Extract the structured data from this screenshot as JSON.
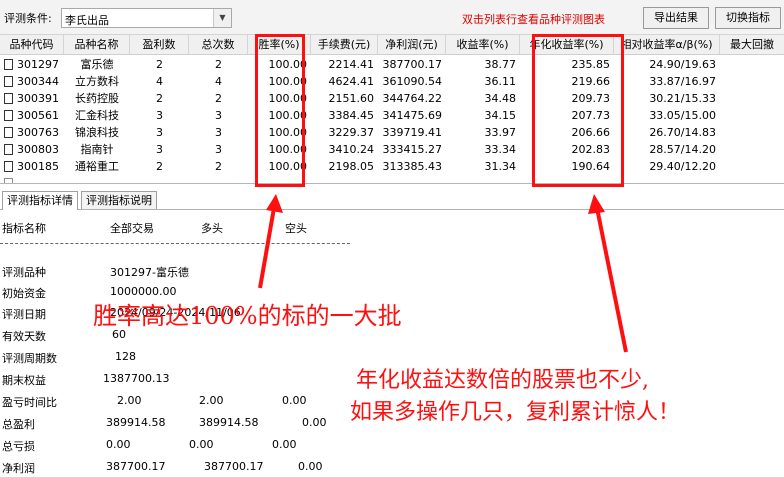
{
  "toolbar": {
    "condition_label": "评测条件:",
    "condition_value": "李氏出品",
    "hint": "双击列表行查看品种评测图表",
    "export_label": "导出结果",
    "switch_label": "切换指标"
  },
  "table": {
    "headers": [
      "品种代码",
      "品种名称",
      "盈利数",
      "总次数",
      "胜率(%)",
      "手续费(元)",
      "净利润(元)",
      "收益率(%)",
      "年化收益率(%)",
      "相对收益率α/β(%)",
      "最大回撤"
    ],
    "rows": [
      [
        "301297",
        "富乐德",
        "2",
        "2",
        "100.00",
        "2214.41",
        "387700.17",
        "38.77",
        "235.85",
        "24.90/19.63"
      ],
      [
        "300344",
        "立方数科",
        "4",
        "4",
        "100.00",
        "4624.41",
        "361090.54",
        "36.11",
        "219.66",
        "33.87/16.97"
      ],
      [
        "300391",
        "长药控股",
        "2",
        "2",
        "100.00",
        "2151.60",
        "344764.22",
        "34.48",
        "209.73",
        "30.21/15.33"
      ],
      [
        "300561",
        "汇金科技",
        "3",
        "3",
        "100.00",
        "3384.45",
        "341475.69",
        "34.15",
        "207.73",
        "33.05/15.00"
      ],
      [
        "300763",
        "锦浪科技",
        "3",
        "3",
        "100.00",
        "3229.37",
        "339719.41",
        "33.97",
        "206.66",
        "26.70/14.83"
      ],
      [
        "300803",
        "指南针",
        "3",
        "3",
        "100.00",
        "3410.24",
        "333415.27",
        "33.34",
        "202.83",
        "28.57/14.20"
      ],
      [
        "300185",
        "通裕重工",
        "2",
        "2",
        "100.00",
        "2198.05",
        "313385.43",
        "31.34",
        "190.64",
        "29.40/12.20"
      ]
    ]
  },
  "tabs": [
    "评测指标详情",
    "评测指标说明"
  ],
  "detail": {
    "header": [
      "指标名称",
      "全部交易",
      "多头",
      "空头"
    ],
    "lines": [
      {
        "label": "评测品种",
        "v1": "301297-富乐德",
        "v2": "",
        "v3": ""
      },
      {
        "label": "初始资金",
        "v1": "1000000.00",
        "v2": "",
        "v3": ""
      },
      {
        "label": "评测日期",
        "v1": "2024/09/24-2024/11/06",
        "v2": "",
        "v3": ""
      },
      {
        "label": "有效天数",
        "v1": "60",
        "v2": "",
        "v3": ""
      },
      {
        "label": "评测周期数",
        "v1": "128",
        "v2": "",
        "v3": ""
      },
      {
        "label": "期末权益",
        "v1": "1387700.13",
        "v2": "",
        "v3": ""
      },
      {
        "label": "盈亏时间比",
        "v1": "2.00",
        "v2": "2.00",
        "v3": "0.00"
      },
      {
        "label": "总盈利",
        "v1": "389914.58",
        "v2": "389914.58",
        "v3": "0.00"
      },
      {
        "label": "总亏损",
        "v1": "0.00",
        "v2": "0.00",
        "v3": "0.00"
      },
      {
        "label": "净利润",
        "v1": "387700.17",
        "v2": "387700.17",
        "v3": "0.00"
      }
    ]
  },
  "annotations": {
    "left": "胜率高达100%的标的一大批",
    "right_line1": "年化收益达数倍的股票也不少,",
    "right_line2": "如果多操作几只，复利累计惊人！"
  },
  "colors": {
    "annotation": "#ff1010"
  }
}
